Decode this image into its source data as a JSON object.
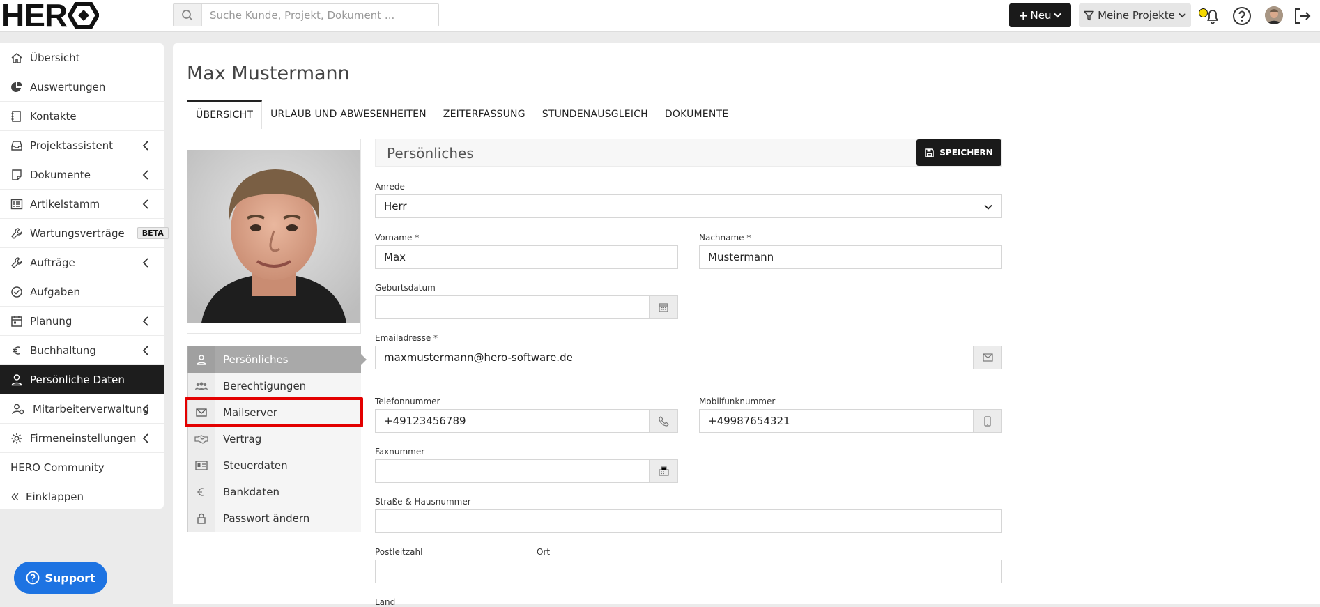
{
  "topbar": {
    "logo_text": "HER",
    "search_placeholder": "Suche Kunde, Projekt, Dokument ...",
    "new_label": "Neu",
    "projects_label": "Meine Projekte"
  },
  "sidebar": {
    "items": [
      {
        "label": "Übersicht",
        "icon": "home-icon"
      },
      {
        "label": "Auswertungen",
        "icon": "pie-chart-icon"
      },
      {
        "label": "Kontakte",
        "icon": "address-book-icon"
      },
      {
        "label": "Projektassistent",
        "icon": "inbox-icon",
        "chevron": true
      },
      {
        "label": "Dokumente",
        "icon": "document-icon",
        "chevron": true
      },
      {
        "label": "Artikelstamm",
        "icon": "list-icon",
        "chevron": true
      },
      {
        "label": "Wartungsverträge",
        "icon": "wrench-icon",
        "badge": "BETA"
      },
      {
        "label": "Aufträge",
        "icon": "wrench-icon",
        "chevron": true
      },
      {
        "label": "Aufgaben",
        "icon": "check-circle-icon"
      },
      {
        "label": "Planung",
        "icon": "calendar-icon",
        "chevron": true
      },
      {
        "label": "Buchhaltung",
        "icon": "euro-icon",
        "chevron": true
      },
      {
        "label": "Persönliche Daten",
        "icon": "user-icon",
        "active": true
      },
      {
        "label": "Mitarbeiterverwaltung",
        "icon": "users-cog-icon",
        "chevron": true
      },
      {
        "label": "Firmeneinstellungen",
        "icon": "gear-icon",
        "chevron": true
      },
      {
        "label": "HERO Community",
        "icon": ""
      },
      {
        "label": "Einklappen",
        "icon": "double-chevron-left-icon"
      }
    ],
    "support_label": "Support"
  },
  "main": {
    "title": "Max Mustermann",
    "tabs": [
      "Übersicht",
      "Urlaub und Abwesenheiten",
      "Zeiterfassung",
      "Stundenausgleich",
      "Dokumente"
    ],
    "submenu": [
      {
        "label": "Persönliches",
        "icon": "user-icon",
        "active": true
      },
      {
        "label": "Berechtigungen",
        "icon": "users-icon"
      },
      {
        "label": "Mailserver",
        "icon": "envelope-icon"
      },
      {
        "label": "Vertrag",
        "icon": "handshake-icon"
      },
      {
        "label": "Steuerdaten",
        "icon": "id-card-icon"
      },
      {
        "label": "Bankdaten",
        "icon": "euro-icon"
      },
      {
        "label": "Passwort ändern",
        "icon": "lock-icon"
      }
    ]
  },
  "form": {
    "section_title": "Persönliches",
    "save_label": "SPEICHERN",
    "anrede_label": "Anrede",
    "anrede_value": "Herr",
    "vorname_label": "Vorname *",
    "vorname_value": "Max",
    "nachname_label": "Nachname *",
    "nachname_value": "Mustermann",
    "geburtsdatum_label": "Geburtsdatum",
    "geburtsdatum_value": "",
    "email_label": "Emailadresse *",
    "email_value": "maxmustermann@hero-software.de",
    "telefon_label": "Telefonnummer",
    "telefon_value": "+49123456789",
    "mobil_label": "Mobilfunknummer",
    "mobil_value": "+49987654321",
    "fax_label": "Faxnummer",
    "fax_value": "",
    "strasse_label": "Straße & Hausnummer",
    "strasse_value": "",
    "plz_label": "Postleitzahl",
    "plz_value": "",
    "ort_label": "Ort",
    "ort_value": "",
    "land_label": "Land"
  }
}
